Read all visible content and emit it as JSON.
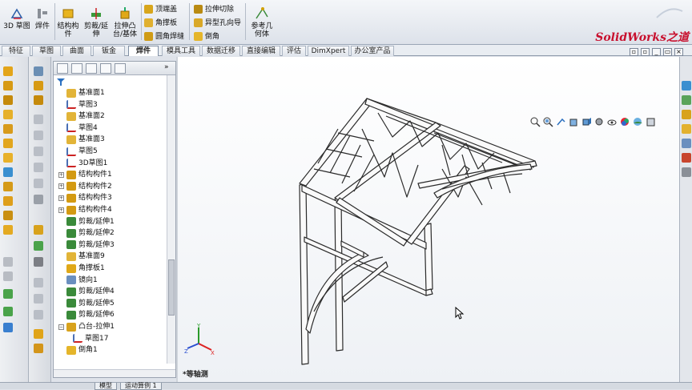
{
  "ribbon": {
    "buttons_large": [
      {
        "id": "sketch3d",
        "label": "3D 草图"
      },
      {
        "id": "weldments",
        "label": "焊件"
      },
      {
        "id": "structural",
        "label": "结构构件"
      },
      {
        "id": "trimextend",
        "label": "剪裁/延伸"
      },
      {
        "id": "extrudeboss",
        "label": "拉伸凸台/基体"
      }
    ],
    "buttons_small": [
      {
        "id": "endcap",
        "label": "顶端盖"
      },
      {
        "id": "gusset",
        "label": "角撑板"
      },
      {
        "id": "filletbead",
        "label": "圆角焊缝"
      },
      {
        "id": "extrudecut",
        "label": "拉伸切除"
      },
      {
        "id": "holewizard",
        "label": "异型孔向导"
      },
      {
        "id": "chamfer",
        "label": "倒角"
      }
    ],
    "refgeom": "参考几何体",
    "logo": "SolidWorks之道"
  },
  "tabs": [
    "特征",
    "草图",
    "曲面",
    "钣金",
    "焊件",
    "模具工具",
    "数据迁移",
    "直接编辑",
    "评估",
    "DimXpert",
    "办公室产品"
  ],
  "active_tab": "焊件",
  "tree": [
    {
      "label": "基准面1",
      "icon": "plane"
    },
    {
      "label": "草图3",
      "icon": "sketch"
    },
    {
      "label": "基准面2",
      "icon": "plane"
    },
    {
      "label": "草图4",
      "icon": "sketch"
    },
    {
      "label": "基准面3",
      "icon": "plane"
    },
    {
      "label": "草图5",
      "icon": "sketch"
    },
    {
      "label": "3D草图1",
      "icon": "sketch3d"
    },
    {
      "label": "结构构件1",
      "icon": "member",
      "expand": "+"
    },
    {
      "label": "结构构件2",
      "icon": "member",
      "expand": "+"
    },
    {
      "label": "结构构件3",
      "icon": "member",
      "expand": "+"
    },
    {
      "label": "结构构件4",
      "icon": "member",
      "expand": "+"
    },
    {
      "label": "剪裁/延伸1",
      "icon": "trim"
    },
    {
      "label": "剪裁/延伸2",
      "icon": "trim"
    },
    {
      "label": "剪裁/延伸3",
      "icon": "trim"
    },
    {
      "label": "基准面9",
      "icon": "plane"
    },
    {
      "label": "角撑板1",
      "icon": "gusset"
    },
    {
      "label": "镜向1",
      "icon": "mirror"
    },
    {
      "label": "剪裁/延伸4",
      "icon": "trim"
    },
    {
      "label": "剪裁/延伸5",
      "icon": "trim"
    },
    {
      "label": "剪裁/延伸6",
      "icon": "trim"
    },
    {
      "label": "凸台-拉伸1",
      "icon": "boss",
      "expand": "−"
    },
    {
      "label": "草图17",
      "icon": "sketch",
      "child": true
    },
    {
      "label": "倒角1",
      "icon": "chamfer"
    }
  ],
  "view": {
    "orientation": "*等轴测"
  },
  "status_tabs": [
    "模型",
    "运动算例 1"
  ],
  "colors": {
    "accent": "#c8102e",
    "tab_active": "#ffffff",
    "frame": "#2b2b2b"
  }
}
